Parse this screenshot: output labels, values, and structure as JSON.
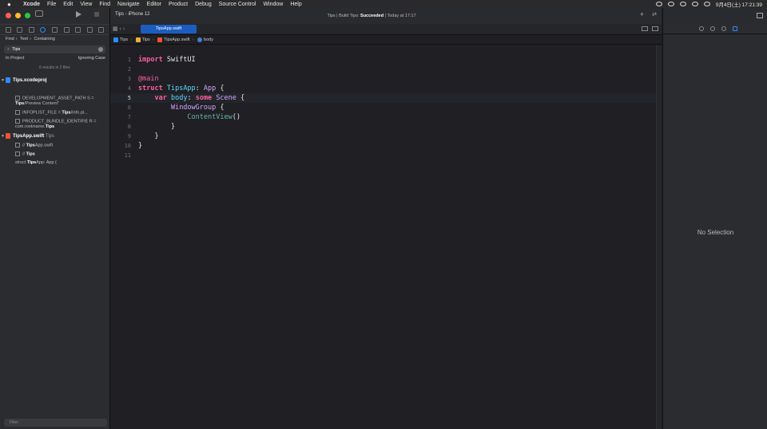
{
  "menubar": {
    "app_name": "Xcode",
    "items": [
      "File",
      "Edit",
      "View",
      "Find",
      "Navigate",
      "Editor",
      "Product",
      "Debug",
      "Source Control",
      "Window",
      "Help"
    ],
    "clock": "9月4日(土)  17:21:39"
  },
  "navigator": {
    "find_path": [
      "Find",
      "Text",
      "Containing"
    ],
    "search_value": "Tips",
    "scope": "In Project",
    "option": "Ignoring Case",
    "results_summary": "6 results in 2 files",
    "filter_placeholder": "Filter",
    "tree": [
      {
        "name": "Tips.xcodeproj",
        "sub": ""
      },
      {
        "name": "TipsApp.swift",
        "sub": "Tips"
      }
    ],
    "results": [
      {
        "pre": "DEVELOPMENT_ASSET_PATH S = ",
        "match": "Tips",
        "post": "/Preview Content\""
      },
      {
        "pre": "INFOPLIST_FILE = ",
        "match": "Tips",
        "post": "/Info.pl..."
      },
      {
        "pre": "PRODUCT_BUNDLE_IDENTIFIE R = com.rookname.",
        "match": "Tips",
        "post": ""
      },
      {
        "pre": "// ",
        "match": "Tips",
        "post": "App.swift"
      },
      {
        "pre": "// ",
        "match": "Tips",
        "post": ""
      },
      {
        "pre": "struct ",
        "match": "Tips",
        "post": "App: App {"
      }
    ]
  },
  "toolbar": {
    "scheme": "Tips",
    "device": "iPhone 12",
    "status_prefix": "Tips | Build Tips: ",
    "status_result": "Succeeded",
    "status_suffix": " | Today at 17:17"
  },
  "editor": {
    "tab_label": "TipsApp.swift",
    "jumpbar": [
      "Tips",
      "Tips",
      "TipsApp.swift",
      "body"
    ],
    "current_line": 5,
    "line_numbers": [
      "1",
      "2",
      "3",
      "4",
      "5",
      "6",
      "7",
      "8",
      "9",
      "10",
      "11"
    ]
  },
  "inspector": {
    "empty_label": "No Selection"
  },
  "colors": {
    "accent": "#2f8cff",
    "keyword": "#fc5fa3",
    "type": "#d0a8ff",
    "declaration": "#5dd8ff",
    "project_ref": "#67b7a4"
  }
}
